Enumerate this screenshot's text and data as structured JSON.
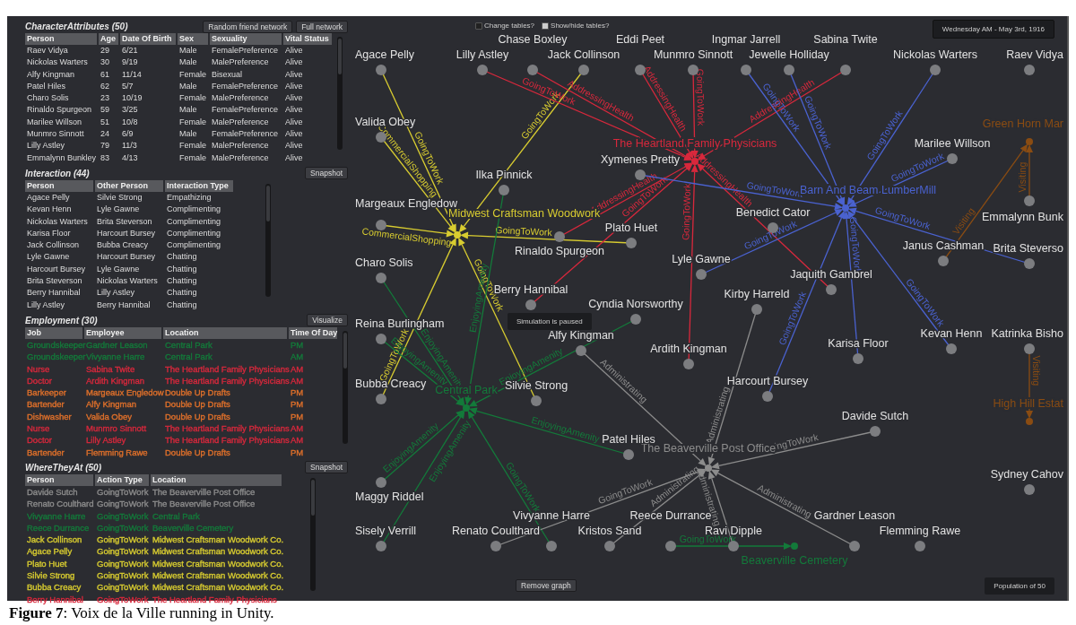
{
  "character_attributes": {
    "title": "CharacterAttributes (50)",
    "buttons": [
      "Random friend network",
      "Full network"
    ],
    "columns": [
      "Person",
      "Age",
      "Date Of Birth",
      "Sex",
      "Sexuality",
      "Vital Status"
    ],
    "rows": [
      [
        "Raev Vidya",
        "29",
        "6/21",
        "Male",
        "FemalePreference",
        "Alive"
      ],
      [
        "Nickolas Warters",
        "30",
        "9/19",
        "Male",
        "MalePreference",
        "Alive"
      ],
      [
        "Alfy Kingman",
        "61",
        "11/14",
        "Female",
        "Bisexual",
        "Alive"
      ],
      [
        "Patel Hiles",
        "62",
        "5/7",
        "Male",
        "FemalePreference",
        "Alive"
      ],
      [
        "Charo Solis",
        "23",
        "10/19",
        "Female",
        "MalePreference",
        "Alive"
      ],
      [
        "Rinaldo Spurgeon",
        "59",
        "3/25",
        "Male",
        "FemalePreference",
        "Alive"
      ],
      [
        "Marilee Willson",
        "51",
        "10/8",
        "Female",
        "MalePreference",
        "Alive"
      ],
      [
        "Munmro Sinnott",
        "24",
        "6/9",
        "Male",
        "FemalePreference",
        "Alive"
      ],
      [
        "Lilly Astley",
        "79",
        "11/3",
        "Female",
        "MalePreference",
        "Alive"
      ],
      [
        "Emmalynn Bunkley",
        "83",
        "4/13",
        "Female",
        "MalePreference",
        "Alive"
      ]
    ]
  },
  "interaction": {
    "title": "Interaction (44)",
    "buttons": [
      "Snapshot"
    ],
    "columns": [
      "Person",
      "Other Person",
      "Interaction Type"
    ],
    "rows": [
      [
        "Agace Pelly",
        "Silvie Strong",
        "Empathizing"
      ],
      [
        "Kevan Henn",
        "Lyle Gawne",
        "Complimenting"
      ],
      [
        "Nickolas Warters",
        "Brita Steverson",
        "Complimenting"
      ],
      [
        "Karisa Floor",
        "Harcourt Bursey",
        "Complimenting"
      ],
      [
        "Jack Collinson",
        "Bubba Creacy",
        "Complimenting"
      ],
      [
        "Lyle Gawne",
        "Harcourt Bursey",
        "Chatting"
      ],
      [
        "Harcourt Bursey",
        "Lyle Gawne",
        "Chatting"
      ],
      [
        "Brita Steverson",
        "Nickolas Warters",
        "Chatting"
      ],
      [
        "Berry Hannibal",
        "Lilly Astley",
        "Chatting"
      ],
      [
        "Lilly Astley",
        "Berry Hannibal",
        "Chatting"
      ]
    ]
  },
  "employment": {
    "title": "Employment (30)",
    "buttons": [
      "Visualize"
    ],
    "columns": [
      "Job",
      "Employee",
      "Location",
      "Time Of Day"
    ],
    "rows": [
      {
        "cells": [
          "Groundskeeper",
          "Gardner Leason",
          "Central Park",
          "PM"
        ],
        "color": "#137a3a"
      },
      {
        "cells": [
          "Groundskeeper",
          "Vivyanne Harre",
          "Central Park",
          "AM"
        ],
        "color": "#137a3a"
      },
      {
        "cells": [
          "Nurse",
          "Sabina Twite",
          "The Heartland Family Physicians",
          "AM"
        ],
        "color": "#d8283c"
      },
      {
        "cells": [
          "Doctor",
          "Ardith Kingman",
          "The Heartland Family Physicians",
          "AM"
        ],
        "color": "#d8283c"
      },
      {
        "cells": [
          "Barkeeper",
          "Margeaux Engledow",
          "Double Up Drafts",
          "PM"
        ],
        "color": "#e0702a"
      },
      {
        "cells": [
          "Bartender",
          "Alfy Kingman",
          "Double Up Drafts",
          "PM"
        ],
        "color": "#e0702a"
      },
      {
        "cells": [
          "Dishwasher",
          "Valida Obey",
          "Double Up Drafts",
          "PM"
        ],
        "color": "#e0702a"
      },
      {
        "cells": [
          "Nurse",
          "Munmro Sinnott",
          "The Heartland Family Physicians",
          "AM"
        ],
        "color": "#d8283c"
      },
      {
        "cells": [
          "Doctor",
          "Lilly Astley",
          "The Heartland Family Physicians",
          "AM"
        ],
        "color": "#d8283c"
      },
      {
        "cells": [
          "Bartender",
          "Flemming Rawe",
          "Double Up Drafts",
          "PM"
        ],
        "color": "#e0702a"
      }
    ]
  },
  "where_they_at": {
    "title": "WhereTheyAt (50)",
    "buttons": [
      "Snapshot"
    ],
    "columns": [
      "Person",
      "Action Type",
      "Location"
    ],
    "rows": [
      {
        "cells": [
          "Davide Sutch",
          "GoingToWork",
          "The Beaverville Post Office"
        ],
        "color": "#8c8c8c"
      },
      {
        "cells": [
          "Renato Coulthard",
          "GoingToWork",
          "The Beaverville Post Office"
        ],
        "color": "#8c8c8c"
      },
      {
        "cells": [
          "Vivyanne Harre",
          "GoingToWork",
          "Central Park"
        ],
        "color": "#137a3a"
      },
      {
        "cells": [
          "Reece Durrance",
          "GoingToWork",
          "Beaverville Cemetery"
        ],
        "color": "#137a3a"
      },
      {
        "cells": [
          "Jack Collinson",
          "GoingToWork",
          "Midwest Craftsman Woodwork Co."
        ],
        "color": "#d8cc30"
      },
      {
        "cells": [
          "Agace Pelly",
          "GoingToWork",
          "Midwest Craftsman Woodwork Co."
        ],
        "color": "#d8cc30"
      },
      {
        "cells": [
          "Plato Huet",
          "GoingToWork",
          "Midwest Craftsman Woodwork Co."
        ],
        "color": "#d8cc30"
      },
      {
        "cells": [
          "Silvie Strong",
          "GoingToWork",
          "Midwest Craftsman Woodwork Co."
        ],
        "color": "#d8cc30"
      },
      {
        "cells": [
          "Bubba Creacy",
          "GoingToWork",
          "Midwest Craftsman Woodwork Co."
        ],
        "color": "#d8cc30"
      },
      {
        "cells": [
          "Berry Hannibal",
          "GoingToWork",
          "The Heartland Family Physicians"
        ],
        "color": "#d8283c"
      }
    ]
  },
  "toggles": [
    {
      "label": "Change tables?",
      "checked": false
    },
    {
      "label": "Show/hide tables?",
      "checked": true
    }
  ],
  "date": "Wednesday AM - May 3rd, 1916",
  "status": "Simulation is paused",
  "remove_button": "Remove graph",
  "population": "Population of 50",
  "graph": {
    "places": [
      {
        "name": "Midwest Craftsman Woodwork",
        "color": "#d8cc30",
        "visitors": [
          {
            "name": "Agace Pelly",
            "edge_label": "GoingToWork"
          },
          {
            "name": "Valida Obey",
            "edge_label": "CommercialShopping"
          },
          {
            "name": "Margeaux Engledow",
            "edge_label": "CommercialShopping"
          },
          {
            "name": "Jack Collinson",
            "edge_label": "GoingToWork"
          },
          {
            "name": "Plato Huet",
            "edge_label": "GoingToWork"
          },
          {
            "name": "Bubba Creacy",
            "edge_label": "GoingToWork"
          },
          {
            "name": "Silvie Strong",
            "edge_label": "GoingToWork"
          }
        ]
      },
      {
        "name": "The Heartland Family Physicians",
        "color": "#d8283c",
        "visitors": [
          {
            "name": "Lilly Astley",
            "edge_label": "GoingToWork"
          },
          {
            "name": "Chase Boxley",
            "edge_label": "AddressingHealth"
          },
          {
            "name": "Eddi Peet",
            "edge_label": "AddressingHealth"
          },
          {
            "name": "Munmro Sinnott",
            "edge_label": "GoingToWork"
          },
          {
            "name": "Sabina Twite",
            "edge_label": "AddressingHealth"
          },
          {
            "name": "Rinaldo Spurgeon",
            "edge_label": "AddressingHealth"
          },
          {
            "name": "Berry Hannibal",
            "edge_label": "GoingToWork"
          },
          {
            "name": "Jaquith Gambrel",
            "edge_label": "AddressingHealth"
          },
          {
            "name": "Ardith Kingman",
            "edge_label": "GoingToWork"
          }
        ]
      },
      {
        "name": "Barn And Beam LumberMill",
        "color": "#4a62d0",
        "visitors": [
          {
            "name": "Ingmar Jarrell",
            "edge_label": "GoingToWork"
          },
          {
            "name": "Jewelle Holliday",
            "edge_label": "GoingToWork"
          },
          {
            "name": "Nickolas Warters",
            "edge_label": "GoingToWork"
          },
          {
            "name": "Marilee Willson",
            "edge_label": "GoingToWork"
          },
          {
            "name": "Xymenes Pretty",
            "edge_label": "GoingToWork"
          },
          {
            "name": "Lyle Gawne",
            "edge_label": "GoingToWork"
          },
          {
            "name": "Brita Steverso",
            "edge_label": "GoingToWork"
          },
          {
            "name": "Harcourt Bursey",
            "edge_label": "GoingToWork"
          },
          {
            "name": "Karisa Floor",
            "edge_label": "GoingToWork"
          },
          {
            "name": "Kevan Henn",
            "edge_label": "GoingToWork"
          }
        ]
      },
      {
        "name": "Central Park",
        "color": "#137a3a",
        "visitors": [
          {
            "name": "Charo Solis",
            "edge_label": "EnjoyingAmenity"
          },
          {
            "name": "Reina Burlingham",
            "edge_label": "EnjoyingAmenity"
          },
          {
            "name": "Ilka Pinnick",
            "edge_label": "EnjoyingAmenity"
          },
          {
            "name": "Cyndia Norsworthy",
            "edge_label": "EnjoyingAmenity"
          },
          {
            "name": "Patel Hiles",
            "edge_label": "EnjoyingAmenity"
          },
          {
            "name": "Maggy Riddel",
            "edge_label": "EnjoyingAmenity"
          },
          {
            "name": "Sisely Verrill",
            "edge_label": "EnjoyingAmenity"
          },
          {
            "name": "Vivyanne Harre",
            "edge_label": "GoingToWork"
          }
        ]
      },
      {
        "name": "The Beaverville Post Office",
        "color": "#8c8c8c",
        "visitors": [
          {
            "name": "Alfy Kingman",
            "edge_label": "Administrating"
          },
          {
            "name": "Kirby Harreld",
            "edge_label": "Administrating"
          },
          {
            "name": "Davide Sutch",
            "edge_label": "GoingToWork"
          },
          {
            "name": "Renato Coulthard",
            "edge_label": "GoingToWork"
          },
          {
            "name": "Kristos Sand",
            "edge_label": "Administrating"
          },
          {
            "name": "Ravi Dipple",
            "edge_label": "Administrating"
          },
          {
            "name": "Gardner Leason",
            "edge_label": "Administrating"
          }
        ]
      },
      {
        "name": "Beaverville Cemetery",
        "color": "#137a3a",
        "visitors": [
          {
            "name": "Reece Durrance",
            "edge_label": "GoingToWork"
          }
        ]
      },
      {
        "name": "Green Horn Mar",
        "color": "#8a4c12",
        "visitors": [
          {
            "name": "Janus Cashman",
            "edge_label": "Visiting"
          },
          {
            "name": "Emmalynn Bunk",
            "edge_label": "Visiting"
          }
        ]
      },
      {
        "name": "High Hill Estat",
        "color": "#8a4c12",
        "visitors": [
          {
            "name": "Katrinka Bisho",
            "edge_label": "Visiting"
          }
        ]
      }
    ],
    "unlinked": [
      "Raev Vidya",
      "Benedict Cator",
      "Sydney Cahov",
      "Flemming Rawe"
    ]
  },
  "caption": "**Figure 7**: Voix de la Ville running in Unity."
}
